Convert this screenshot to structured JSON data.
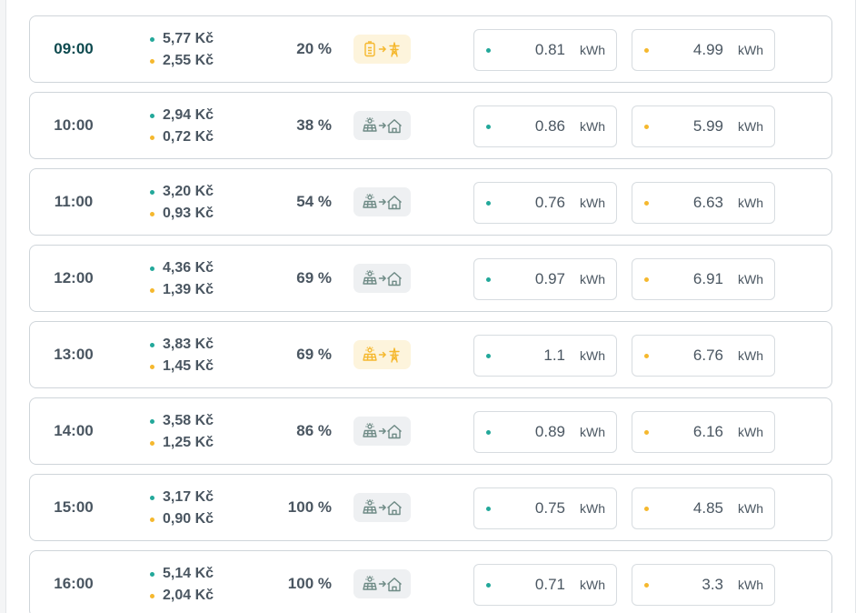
{
  "colors": {
    "accent_teal": "#23a89a",
    "accent_amber": "#f5b82e",
    "mode_default_bg": "#eef0f2",
    "mode_warn_bg": "#fdf4dc"
  },
  "unit_label": "kWh",
  "rows": [
    {
      "time": "09:00",
      "buy_price": "5,77 Kč",
      "sell_price": "2,55 Kč",
      "battery": "20 %",
      "mode_icon": "battery-to-grid-icon",
      "mode_warn": true,
      "current": true,
      "value_teal": "0.81",
      "value_amber": "4.99"
    },
    {
      "time": "10:00",
      "buy_price": "2,94 Kč",
      "sell_price": "0,72 Kč",
      "battery": "38 %",
      "mode_icon": "solar-to-home-icon",
      "mode_warn": false,
      "current": false,
      "value_teal": "0.86",
      "value_amber": "5.99"
    },
    {
      "time": "11:00",
      "buy_price": "3,20 Kč",
      "sell_price": "0,93 Kč",
      "battery": "54 %",
      "mode_icon": "solar-to-home-icon",
      "mode_warn": false,
      "current": false,
      "value_teal": "0.76",
      "value_amber": "6.63"
    },
    {
      "time": "12:00",
      "buy_price": "4,36 Kč",
      "sell_price": "1,39 Kč",
      "battery": "69 %",
      "mode_icon": "solar-to-home-icon",
      "mode_warn": false,
      "current": false,
      "value_teal": "0.97",
      "value_amber": "6.91"
    },
    {
      "time": "13:00",
      "buy_price": "3,83 Kč",
      "sell_price": "1,45 Kč",
      "battery": "69 %",
      "mode_icon": "solar-to-grid-icon",
      "mode_warn": true,
      "current": false,
      "value_teal": "1.1",
      "value_amber": "6.76"
    },
    {
      "time": "14:00",
      "buy_price": "3,58 Kč",
      "sell_price": "1,25 Kč",
      "battery": "86 %",
      "mode_icon": "solar-to-home-icon",
      "mode_warn": false,
      "current": false,
      "value_teal": "0.89",
      "value_amber": "6.16"
    },
    {
      "time": "15:00",
      "buy_price": "3,17 Kč",
      "sell_price": "0,90 Kč",
      "battery": "100 %",
      "mode_icon": "solar-to-home-icon",
      "mode_warn": false,
      "current": false,
      "value_teal": "0.75",
      "value_amber": "4.85"
    },
    {
      "time": "16:00",
      "buy_price": "5,14 Kč",
      "sell_price": "2,04 Kč",
      "battery": "100 %",
      "mode_icon": "solar-to-home-icon",
      "mode_warn": false,
      "current": false,
      "value_teal": "0.71",
      "value_amber": "3.3"
    }
  ]
}
